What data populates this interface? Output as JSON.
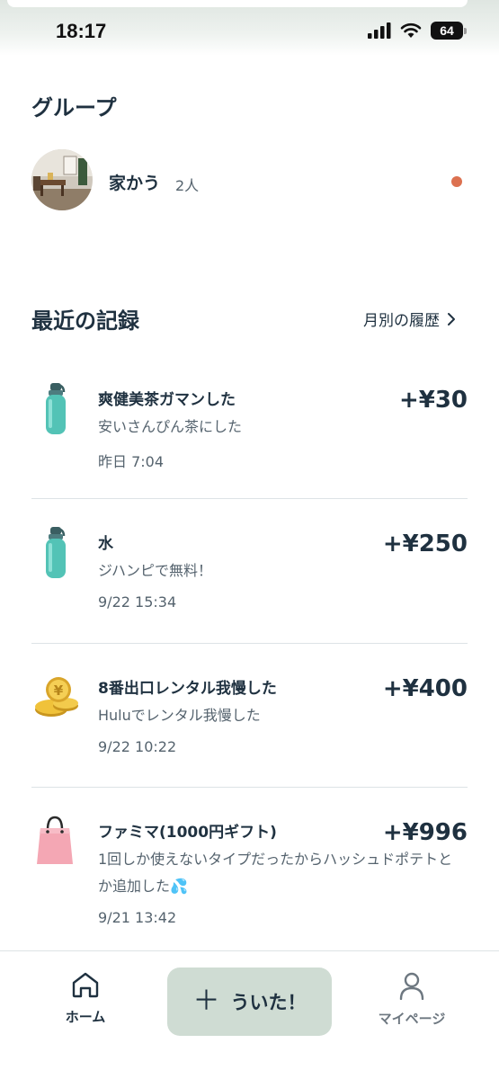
{
  "status_bar": {
    "time": "18:17",
    "battery": "64"
  },
  "group_section": {
    "title": "グループ",
    "group": {
      "name": "家かう",
      "member_count": "2人",
      "has_unread": true
    }
  },
  "recent_section": {
    "title": "最近の記録",
    "history_link": "月別の履歴"
  },
  "records": [
    {
      "icon": "water-bottle-icon",
      "title": "爽健美茶ガマンした",
      "memo": "安いさんぴん茶にした",
      "time": "昨日 7:04",
      "amount": "+¥30"
    },
    {
      "icon": "water-bottle-icon",
      "title": "水",
      "memo": "ジハンピで無料！",
      "time": "9/22 15:34",
      "amount": "+¥250"
    },
    {
      "icon": "gold-coins-icon",
      "title": "8番出口レンタル我慢した",
      "memo": "Huluでレンタル我慢した",
      "time": "9/22 10:22",
      "amount": "+¥400"
    },
    {
      "icon": "shopping-bag-icon",
      "title": "ファミマ(1000円ギフト)",
      "memo": "1回しか使えないタイプだったからハッシュドポテトとか追加した💦",
      "time": "9/21 13:42",
      "amount": "+¥996"
    }
  ],
  "tab_bar": {
    "home_label": "ホーム",
    "add_label": "ういた！",
    "mypage_label": "マイページ"
  },
  "colors": {
    "text_primary": "#1f3140",
    "text_secondary": "#55636e",
    "accent_button": "#cfdcd3",
    "unread_dot": "#dc7150"
  }
}
